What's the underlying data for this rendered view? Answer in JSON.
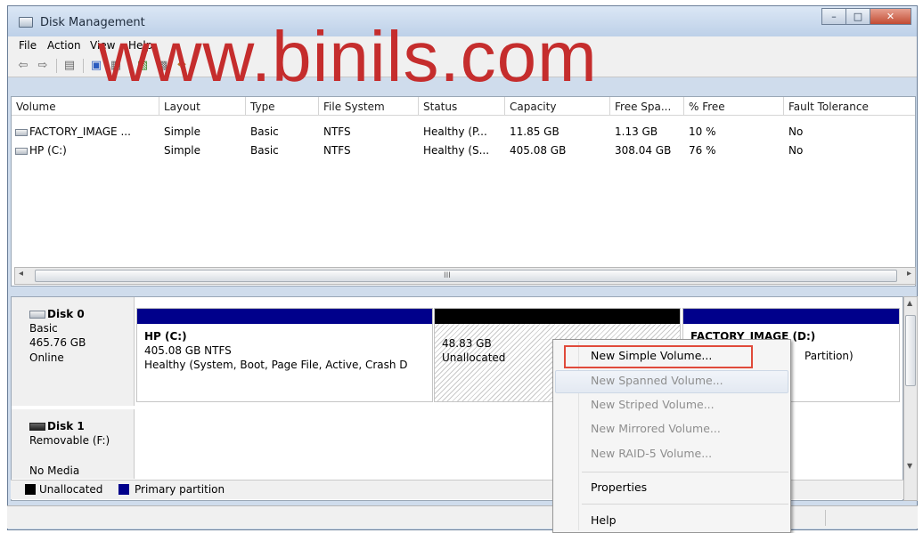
{
  "window": {
    "title": "Disk Management"
  },
  "menu": {
    "file": "File",
    "action": "Action",
    "view": "View",
    "help": "Help"
  },
  "watermark": "www.binils.com",
  "volume_list": {
    "columns": [
      "Volume",
      "Layout",
      "Type",
      "File System",
      "Status",
      "Capacity",
      "Free Spa...",
      "% Free",
      "Fault Tolerance"
    ],
    "rows": [
      [
        "FACTORY_IMAGE ...",
        "Simple",
        "Basic",
        "NTFS",
        "Healthy (P...",
        "11.85 GB",
        "1.13 GB",
        "10 %",
        "No"
      ],
      [
        "HP (C:)",
        "Simple",
        "Basic",
        "NTFS",
        "Healthy (S...",
        "405.08 GB",
        "308.04 GB",
        "76 %",
        "No"
      ]
    ],
    "scroll_grip": "III"
  },
  "disks": {
    "disk0": {
      "name": "Disk 0",
      "type": "Basic",
      "size": "465.76 GB",
      "state": "Online",
      "partitions": {
        "c": {
          "title": "HP  (C:)",
          "size": "405.08 GB NTFS",
          "status": "Healthy (System, Boot, Page File, Active, Crash D"
        },
        "unalloc": {
          "size": "48.83 GB",
          "status": "Unallocated"
        },
        "d": {
          "title": "FACTORY_IMAGE  (D:)",
          "status": "Partition)"
        }
      }
    },
    "disk1": {
      "name": "Disk 1",
      "type": "Removable (F:)",
      "media": "No Media"
    }
  },
  "legend": {
    "unallocated": "Unallocated",
    "primary": "Primary partition"
  },
  "context_menu": {
    "new_simple": "New Simple Volume...",
    "new_spanned": "New Spanned Volume...",
    "new_striped": "New Striped Volume...",
    "new_mirrored": "New Mirrored Volume...",
    "new_raid5": "New RAID-5 Volume...",
    "properties": "Properties",
    "help": "Help"
  },
  "colors": {
    "primary_partition": "#00008b",
    "unallocated": "#000000",
    "highlight_border": "#e04a3a"
  }
}
